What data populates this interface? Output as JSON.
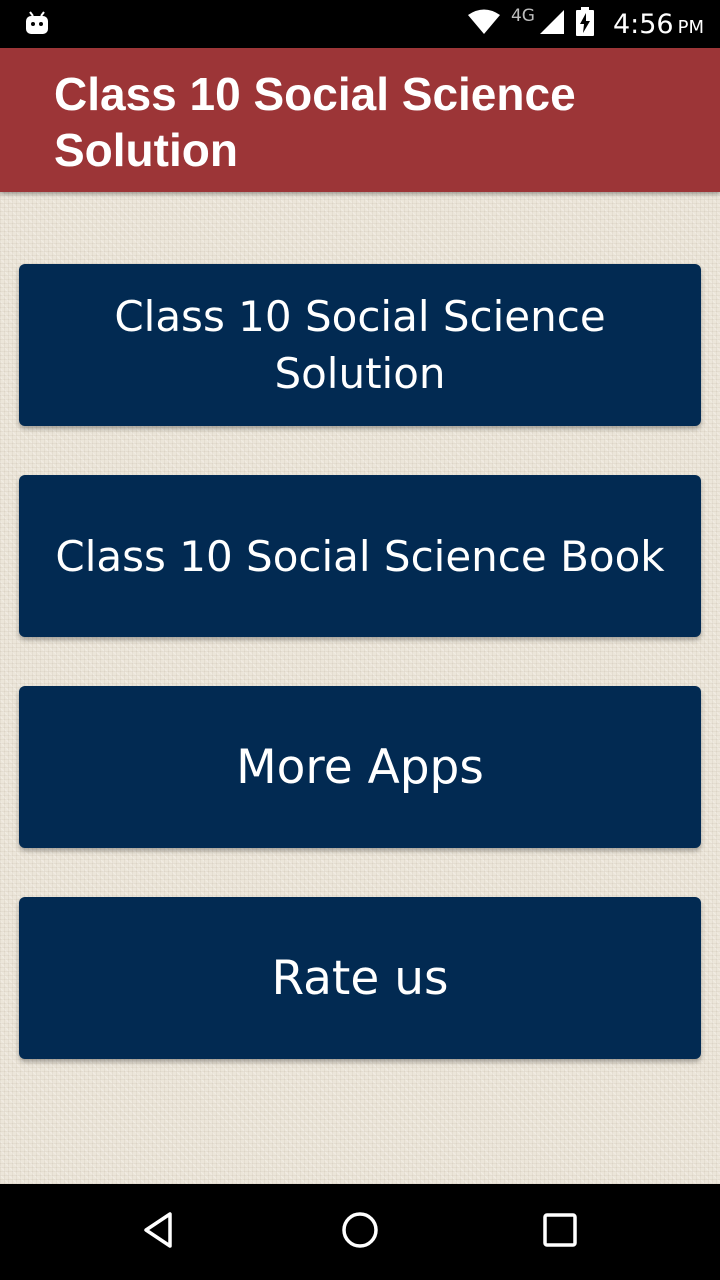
{
  "status_bar": {
    "network": "4G",
    "time": "4:56",
    "ampm": "PM"
  },
  "app_bar": {
    "title": "Class 10 Social Science Solution"
  },
  "menu": {
    "items": [
      {
        "label": "Class 10 Social Science Solution"
      },
      {
        "label": "Class 10 Social Science Book"
      },
      {
        "label": "More Apps"
      },
      {
        "label": "Rate us"
      }
    ]
  },
  "colors": {
    "app_bar": "#9c3537",
    "button": "#022a52",
    "background": "#ece6da"
  },
  "icons": {
    "status_left": "android-notification-icon",
    "wifi": "wifi-icon",
    "signal": "cell-signal-icon",
    "battery": "battery-charging-icon",
    "nav_back": "back-triangle-icon",
    "nav_home": "home-circle-icon",
    "nav_recent": "recent-apps-square-icon"
  }
}
